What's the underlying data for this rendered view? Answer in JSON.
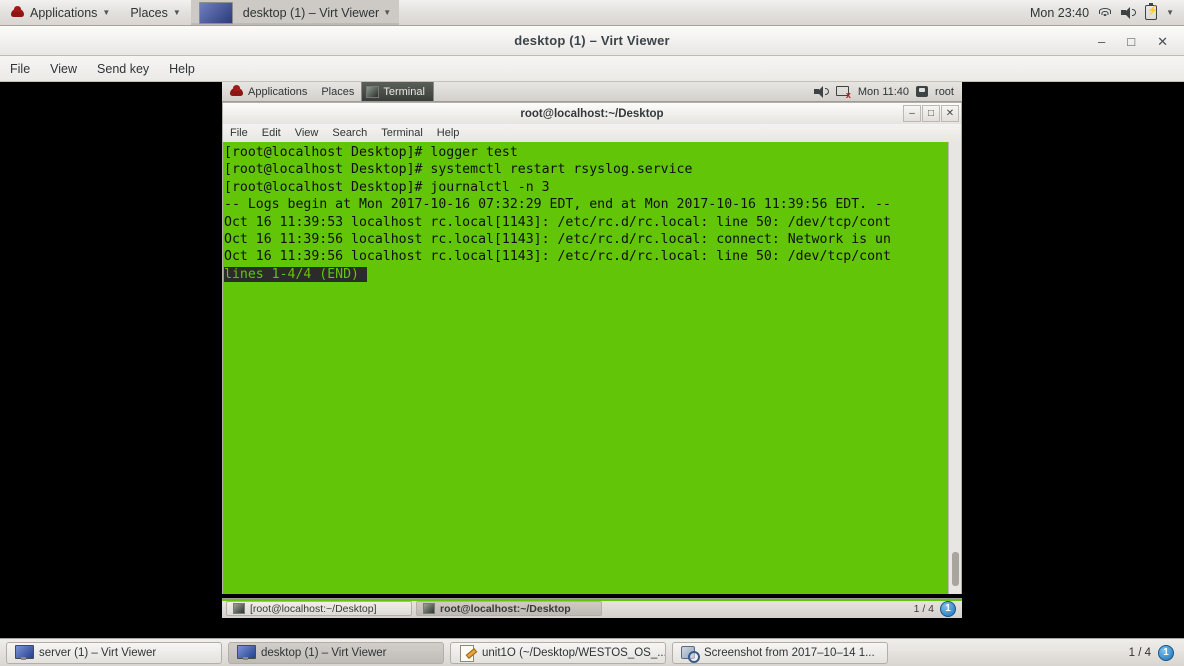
{
  "host_panel": {
    "applications": "Applications",
    "places": "Places",
    "active_window": "desktop (1) – Virt Viewer",
    "clock": "Mon 23:40",
    "tray": [
      "wifi-icon",
      "volume-icon",
      "battery-icon",
      "chevron-down-icon"
    ]
  },
  "virt_viewer": {
    "title": "desktop (1) – Virt Viewer",
    "window_buttons": {
      "minimize": "–",
      "maximize": "□",
      "close": "✕"
    },
    "menus": [
      "File",
      "View",
      "Send key",
      "Help"
    ]
  },
  "guest_panel": {
    "applications": "Applications",
    "places": "Places",
    "window_button": "Terminal",
    "clock": "Mon 11:40",
    "user": "root"
  },
  "terminal": {
    "title": "root@localhost:~/Desktop",
    "window_buttons": {
      "minimize": "–",
      "maximize": "□",
      "close": "✕"
    },
    "menus": [
      "File",
      "Edit",
      "View",
      "Search",
      "Terminal",
      "Help"
    ],
    "colors": {
      "background": "#62c508",
      "foreground": "#101010",
      "highlight_bg": "#2b2b2b"
    },
    "lines": [
      {
        "text": "[root@localhost Desktop]# logger test",
        "highlight": false
      },
      {
        "text": "[root@localhost Desktop]# systemctl restart rsyslog.service",
        "highlight": false
      },
      {
        "text": "[root@localhost Desktop]# journalctl -n 3",
        "highlight": false
      },
      {
        "text": "-- Logs begin at Mon 2017-10-16 07:32:29 EDT, end at Mon 2017-10-16 11:39:56 EDT. --",
        "highlight": false
      },
      {
        "text": "Oct 16 11:39:53 localhost rc.local[1143]: /etc/rc.d/rc.local: line 50: /dev/tcp/cont",
        "highlight": false
      },
      {
        "text": "Oct 16 11:39:56 localhost rc.local[1143]: /etc/rc.d/rc.local: connect: Network is un",
        "highlight": false
      },
      {
        "text": "Oct 16 11:39:56 localhost rc.local[1143]: /etc/rc.d/rc.local: line 50: /dev/tcp/cont",
        "highlight": false
      },
      {
        "text": "lines 1-4/4 (END)",
        "highlight": true
      }
    ]
  },
  "guest_taskbar": {
    "items": [
      {
        "label": "[root@localhost:~/Desktop]",
        "selected": false
      },
      {
        "label": "root@localhost:~/Desktop",
        "selected": true
      }
    ],
    "pager": "1 / 4",
    "workspace_badge": "1"
  },
  "host_taskbar": {
    "items": [
      {
        "label": "server (1) – Virt Viewer",
        "icon": "monitor-icon",
        "selected": false
      },
      {
        "label": "desktop (1) – Virt Viewer",
        "icon": "monitor-icon",
        "selected": true
      },
      {
        "label": "unit1O (~/Desktop/WESTOS_OS_...",
        "icon": "note-icon",
        "selected": false
      },
      {
        "label": "Screenshot from 2017–10–14 1...",
        "icon": "screenshot-icon",
        "selected": false
      }
    ],
    "pager": "1 / 4",
    "workspace_badge": "1"
  }
}
